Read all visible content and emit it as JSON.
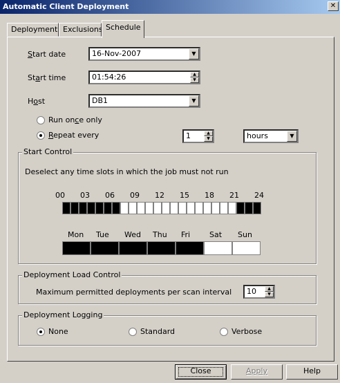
{
  "window": {
    "title": "Automatic Client Deployment",
    "close_glyph": "✕"
  },
  "tabs": [
    {
      "label": "Deployment",
      "active": false
    },
    {
      "label": "Exclusions",
      "active": false
    },
    {
      "label": "Schedule",
      "active": true
    }
  ],
  "schedule": {
    "start_date": {
      "label_pre": "",
      "label_key": "S",
      "label_post": "tart date",
      "value": "16-Nov-2007"
    },
    "start_time": {
      "label_pre": "St",
      "label_key": "a",
      "label_post": "rt time",
      "value": "01:54:26"
    },
    "host": {
      "label_pre": "H",
      "label_key": "o",
      "label_post": "st",
      "value": "DB1"
    },
    "run_once": {
      "label_pre": "Run on",
      "label_key": "c",
      "label_post": "e only",
      "selected": false
    },
    "repeat": {
      "label_pre": "",
      "label_key": "R",
      "label_post": "epeat every",
      "selected": true,
      "value": "1",
      "unit": "hours"
    }
  },
  "start_control": {
    "title": "Start Control",
    "instruction": "Deselect any time slots in which the job must not run",
    "hour_labels": [
      "00",
      "03",
      "06",
      "09",
      "12",
      "15",
      "18",
      "21",
      "24"
    ],
    "hour_slots": [
      true,
      true,
      true,
      true,
      true,
      true,
      true,
      false,
      false,
      false,
      false,
      false,
      false,
      false,
      false,
      false,
      false,
      false,
      false,
      false,
      false,
      true,
      true,
      true
    ],
    "day_labels": [
      "Mon",
      "Tue",
      "Wed",
      "Thu",
      "Fri",
      "Sat",
      "Sun"
    ],
    "day_slots": [
      true,
      true,
      true,
      true,
      true,
      false,
      false
    ]
  },
  "load_control": {
    "title": "Deployment Load Control",
    "label": "Maximum permitted deployments per scan interval",
    "value": "10"
  },
  "logging": {
    "title": "Deployment Logging",
    "options": [
      {
        "label": "None",
        "selected": true
      },
      {
        "label": "Standard",
        "selected": false
      },
      {
        "label": "Verbose",
        "selected": false
      }
    ]
  },
  "buttons": {
    "close": "Close",
    "apply": "Apply",
    "help": "Help"
  },
  "icons": {
    "dropdown": "chevron-down-icon",
    "spin_up": "arrow-up-icon",
    "spin_down": "arrow-down-icon"
  }
}
